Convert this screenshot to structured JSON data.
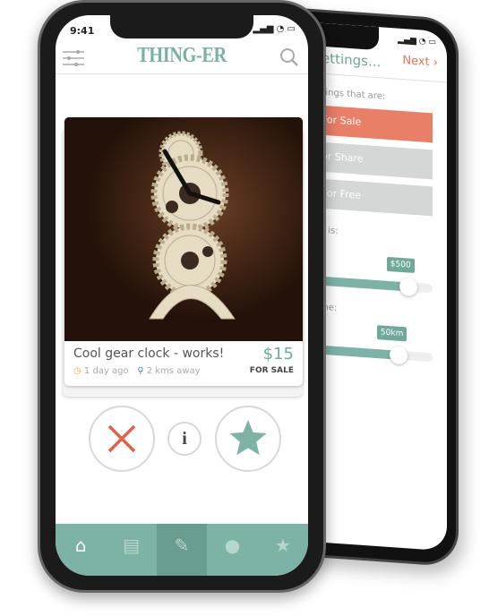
{
  "settings_screen": {
    "title": "ettings...",
    "next_label": "Next",
    "things_label": "hings that are:",
    "options": [
      {
        "label": "For Sale",
        "selected": true
      },
      {
        "label": "or Share",
        "selected": false
      },
      {
        "label": "For Free",
        "selected": false
      }
    ],
    "price_label": "e is:",
    "price_value": "$500",
    "price_fraction": 0.8,
    "distance_label": "me:",
    "distance_value": "50km",
    "distance_fraction": 0.72
  },
  "status_bar": {
    "time": "9:41"
  },
  "header": {
    "logo": "THING-ER"
  },
  "card": {
    "title": "Cool gear clock - works!",
    "posted": "1 day ago",
    "distance": "2 kms away",
    "price": "$15",
    "type": "FOR SALE"
  },
  "colors": {
    "accent": "#7cb3a6",
    "reject": "#e0634b",
    "sale": "#ea7f67"
  },
  "tabs": [
    {
      "icon": "home-icon",
      "active": false
    },
    {
      "icon": "chat-icon",
      "active": false
    },
    {
      "icon": "edit-icon",
      "active": true
    },
    {
      "icon": "profile-icon",
      "active": false
    },
    {
      "icon": "star-icon",
      "active": false
    }
  ]
}
